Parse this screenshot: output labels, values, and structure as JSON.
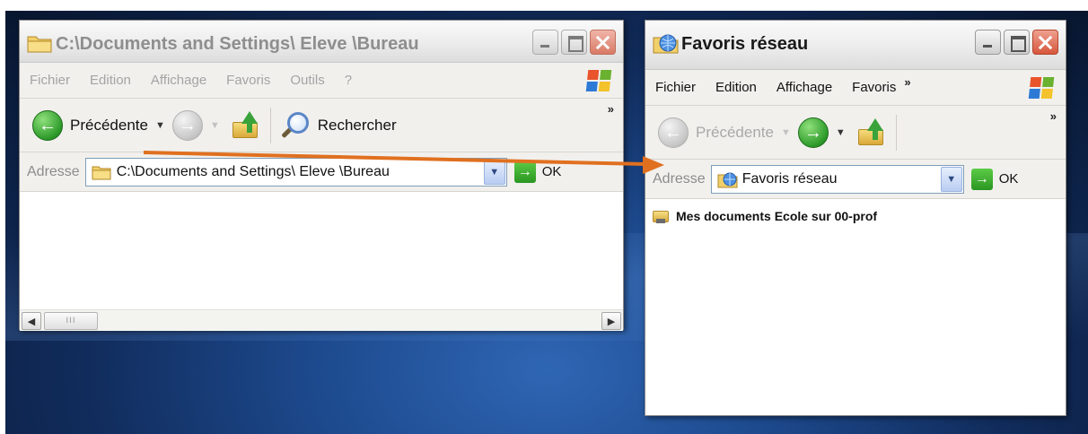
{
  "left_window": {
    "title": "C:\\Documents and Settings\\ Eleve \\Bureau",
    "menu": [
      "Fichier",
      "Edition",
      "Affichage",
      "Favoris",
      "Outils",
      "?"
    ],
    "toolbar": {
      "back_label": "Précédente",
      "search_label": "Rechercher",
      "more": "»"
    },
    "address": {
      "label": "Adresse",
      "value": "C:\\Documents and Settings\\ Eleve \\Bureau",
      "go_label": "OK"
    },
    "scroll_thumb": "III"
  },
  "right_window": {
    "title": "Favoris réseau",
    "menu": [
      "Fichier",
      "Edition",
      "Affichage",
      "Favoris"
    ],
    "menu_more": "»",
    "toolbar": {
      "back_label": "Précédente",
      "more": "»"
    },
    "address": {
      "label": "Adresse",
      "value": "Favoris réseau",
      "go_label": "OK"
    },
    "items": [
      "Mes documents Ecole sur 00-prof"
    ]
  },
  "colors": {
    "arrow": "#e0701f",
    "desktop": "#1d4a8e",
    "close_button": "#d6573c"
  }
}
